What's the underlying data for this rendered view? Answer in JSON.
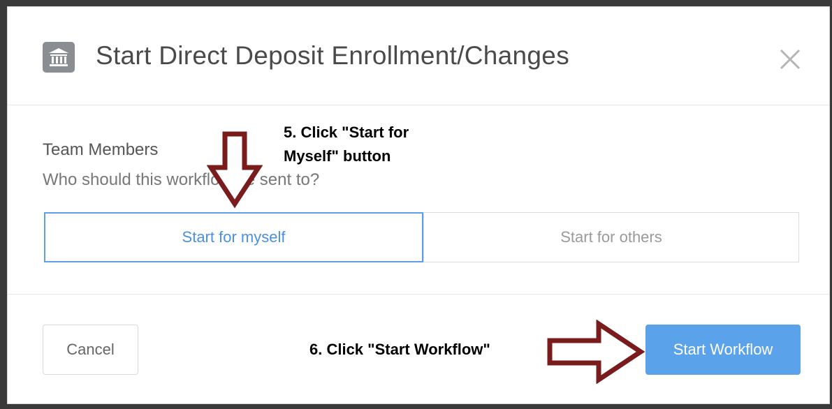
{
  "modal": {
    "title": "Start Direct Deposit Enrollment/Changes",
    "icon": "bank-icon",
    "close_icon": "close-icon"
  },
  "team_members": {
    "label": "Team Members",
    "question": "Who should this workflow be sent to?",
    "options": [
      {
        "label": "Start for myself",
        "selected": true
      },
      {
        "label": "Start for others",
        "selected": false
      }
    ]
  },
  "footer": {
    "cancel_label": "Cancel",
    "start_label": "Start Workflow"
  },
  "annotations": {
    "step5": "5. Click \"Start for Myself\" button",
    "step6": "6. Click \"Start Workflow\""
  },
  "colors": {
    "accent": "#4a90e2",
    "primary_button": "#5aa3ea",
    "annotation_arrow": "#7b1c1c",
    "overlay": "#3a3a3a"
  }
}
